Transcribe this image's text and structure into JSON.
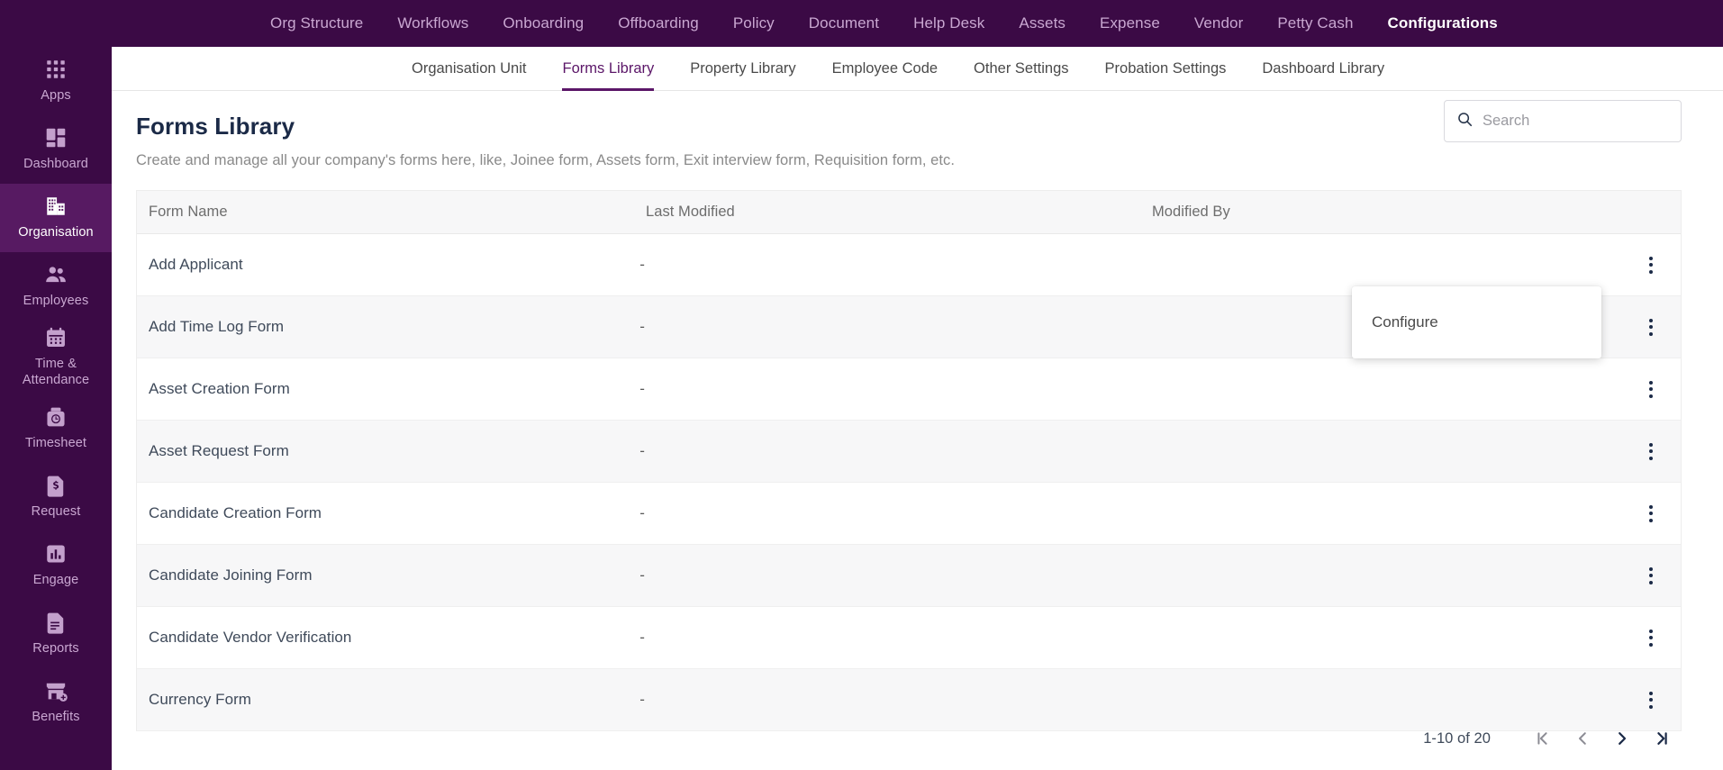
{
  "theme": {
    "brand_purple": "#3B0A45",
    "brand_purple_active": "#571A62",
    "accent": "#5B1668",
    "title_color": "#1B2A47",
    "muted": "#8A8A8A"
  },
  "topnav": {
    "items": [
      {
        "label": "Org Structure",
        "active": false
      },
      {
        "label": "Workflows",
        "active": false
      },
      {
        "label": "Onboarding",
        "active": false
      },
      {
        "label": "Offboarding",
        "active": false
      },
      {
        "label": "Policy",
        "active": false
      },
      {
        "label": "Document",
        "active": false
      },
      {
        "label": "Help Desk",
        "active": false
      },
      {
        "label": "Assets",
        "active": false
      },
      {
        "label": "Expense",
        "active": false
      },
      {
        "label": "Vendor",
        "active": false
      },
      {
        "label": "Petty Cash",
        "active": false
      },
      {
        "label": "Configurations",
        "active": true
      }
    ]
  },
  "sidebar": {
    "items": [
      {
        "label": "Apps",
        "icon": "grid-apps-icon",
        "active": false
      },
      {
        "label": "Dashboard",
        "icon": "dashboard-icon",
        "active": false
      },
      {
        "label": "Organisation",
        "icon": "building-icon",
        "active": true
      },
      {
        "label": "Employees",
        "icon": "people-icon",
        "active": false
      },
      {
        "label": "Time & Attendance",
        "icon": "calendar-icon",
        "active": false
      },
      {
        "label": "Timesheet",
        "icon": "clock-bag-icon",
        "active": false
      },
      {
        "label": "Request",
        "icon": "money-document-icon",
        "active": false
      },
      {
        "label": "Engage",
        "icon": "bar-chart-icon",
        "active": false
      },
      {
        "label": "Reports",
        "icon": "report-document-icon",
        "active": false
      },
      {
        "label": "Benefits",
        "icon": "store-plus-icon",
        "active": false
      }
    ]
  },
  "subnav": {
    "items": [
      {
        "label": "Organisation Unit",
        "active": false
      },
      {
        "label": "Forms Library",
        "active": true
      },
      {
        "label": "Property Library",
        "active": false
      },
      {
        "label": "Employee Code",
        "active": false
      },
      {
        "label": "Other Settings",
        "active": false
      },
      {
        "label": "Probation Settings",
        "active": false
      },
      {
        "label": "Dashboard Library",
        "active": false
      }
    ]
  },
  "page": {
    "title": "Forms Library",
    "subtitle": "Create and manage all your company's forms here, like, Joinee form, Assets form, Exit interview form, Requisition form, etc."
  },
  "search": {
    "placeholder": "Search",
    "value": "",
    "icon": "search-icon"
  },
  "table": {
    "columns": [
      "Form Name",
      "Last Modified",
      "Modified By"
    ],
    "rows": [
      {
        "name": "Add Applicant",
        "last_modified": "-",
        "modified_by": ""
      },
      {
        "name": "Add Time Log Form",
        "last_modified": "-",
        "modified_by": ""
      },
      {
        "name": "Asset Creation Form",
        "last_modified": "-",
        "modified_by": ""
      },
      {
        "name": "Asset Request Form",
        "last_modified": "-",
        "modified_by": ""
      },
      {
        "name": "Candidate Creation Form",
        "last_modified": "-",
        "modified_by": ""
      },
      {
        "name": "Candidate Joining Form",
        "last_modified": "-",
        "modified_by": ""
      },
      {
        "name": "Candidate Vendor Verification",
        "last_modified": "-",
        "modified_by": ""
      },
      {
        "name": "Currency Form",
        "last_modified": "-",
        "modified_by": ""
      }
    ]
  },
  "context_menu": {
    "open": true,
    "items": [
      "Configure"
    ],
    "configure_label": "Configure"
  },
  "pagination": {
    "range_label": "1-10 of 20",
    "first_label": "|<",
    "prev_label": "<",
    "next_label": ">",
    "last_label": ">|"
  }
}
